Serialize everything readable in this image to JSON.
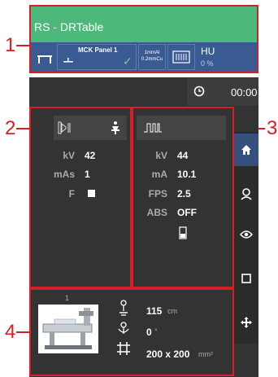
{
  "header": {
    "title": "RS - DRTable",
    "panel_name": "MCK Panel 1",
    "filter_line1": "1mmAl",
    "filter_line2": "0.2mmCu",
    "hu_label": "HU",
    "hu_value": "0 %"
  },
  "timer": {
    "value": "00:00"
  },
  "callouts": {
    "c1": "1",
    "c2": "2",
    "c3": "3",
    "c4": "4"
  },
  "left_panel": {
    "kv_label": "kV",
    "kv_value": "42",
    "mas_label": "mAs",
    "mas_value": "1",
    "f_label": "F"
  },
  "right_panel": {
    "kv_label": "kV",
    "kv_value": "44",
    "ma_label": "mA",
    "ma_value": "10.1",
    "fps_label": "FPS",
    "fps_value": "2.5",
    "abs_label": "ABS",
    "abs_value": "OFF"
  },
  "bottom_panel": {
    "thumb_index": "1",
    "distance_value": "115",
    "distance_unit": "cm",
    "angle_value": "0",
    "angle_unit": "°",
    "field_value": "200 x 200",
    "field_unit": "mm²"
  },
  "colors": {
    "accent_green": "#4cb87a",
    "header_blue": "#3a5b92",
    "callout_red": "#d4202a",
    "dark_bg": "#333333"
  },
  "icons": [
    "table-icon",
    "detector-icon",
    "checkmark-icon",
    "grid-icon",
    "clock-icon",
    "collimator-icon",
    "patient-icon",
    "pulse-icon",
    "detector-small-icon",
    "home-icon",
    "person-icon",
    "eye-icon",
    "square-icon",
    "move-icon",
    "sid-icon",
    "angle-icon",
    "field-size-icon"
  ]
}
